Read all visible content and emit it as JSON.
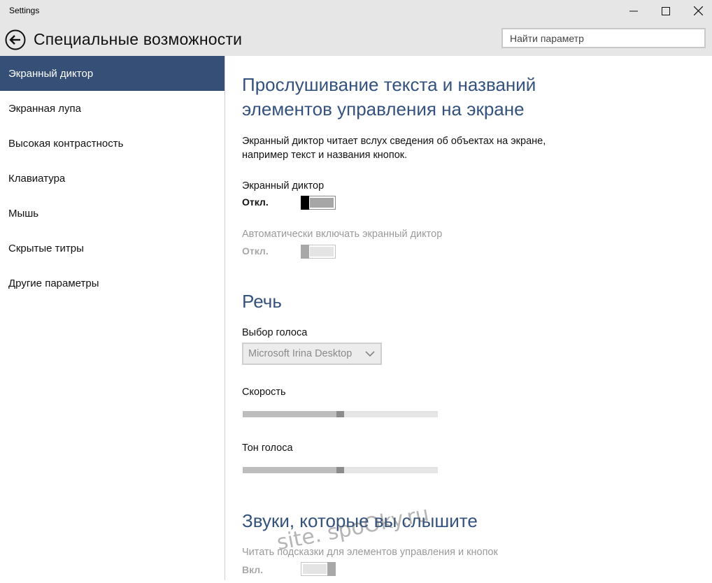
{
  "window": {
    "title": "Settings"
  },
  "header": {
    "title": "Специальные возможности",
    "search_placeholder": "Найти параметр"
  },
  "sidebar": {
    "items": [
      {
        "label": "Экранный диктор",
        "active": true
      },
      {
        "label": "Экранная лупа"
      },
      {
        "label": "Высокая контрастность"
      },
      {
        "label": "Клавиатура"
      },
      {
        "label": "Мышь"
      },
      {
        "label": "Скрытые титры"
      },
      {
        "label": "Другие параметры"
      }
    ]
  },
  "main": {
    "heading": "Прослушивание текста и названий элементов управления на экране",
    "description": "Экранный диктор читает вслух сведения об объектах на экране, например текст и названия кнопок.",
    "narrator": {
      "label": "Экранный диктор",
      "state": "Откл."
    },
    "auto_narrator": {
      "label": "Автоматически включать экранный диктор",
      "state": "Откл."
    },
    "speech": {
      "heading": "Речь",
      "voice_label": "Выбор голоса",
      "voice_value": "Microsoft Irina Desktop",
      "speed_label": "Скорость",
      "speed_value": 0.5,
      "pitch_label": "Тон голоса",
      "pitch_value": 0.5
    },
    "sounds": {
      "heading": "Звуки, которые вы слышите",
      "hints_label": "Читать подсказки для элементов управления и кнопок",
      "hints_state": "Вкл."
    }
  },
  "watermark": "site. spoOky.ru",
  "colors": {
    "accent": "#364f77",
    "heading": "#34527d",
    "chrome": "#e6e6e6"
  }
}
